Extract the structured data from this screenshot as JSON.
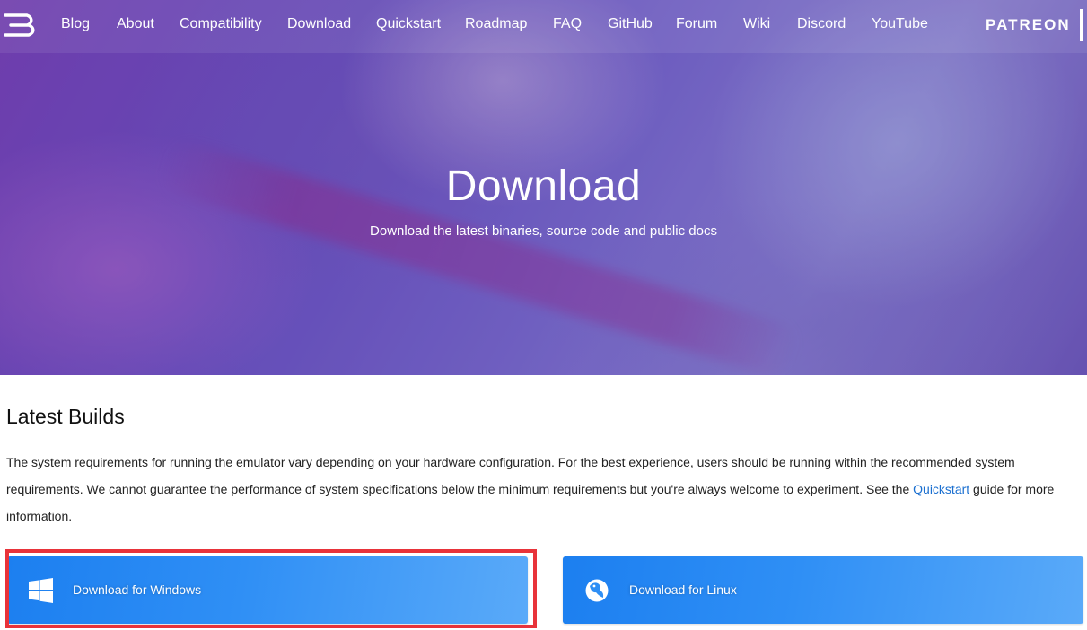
{
  "nav": {
    "logo_icon": "yuzu-logo-icon",
    "links": [
      {
        "label": "Blog"
      },
      {
        "label": "About"
      },
      {
        "label": "Compatibility"
      },
      {
        "label": "Download"
      },
      {
        "label": "Quickstart"
      },
      {
        "label": "Roadmap"
      },
      {
        "label": "FAQ"
      },
      {
        "label": "GitHub"
      },
      {
        "label": "Forum"
      },
      {
        "label": "Wiki"
      },
      {
        "label": "Discord"
      },
      {
        "label": "YouTube"
      }
    ],
    "patreon_label": "PATREON"
  },
  "hero": {
    "title": "Download",
    "subtitle": "Download the latest binaries, source code and public docs"
  },
  "content": {
    "section_title": "Latest Builds",
    "description_before": "The system requirements for running the emulator vary depending on your hardware configuration. For the best experience, users should be running within the recommended system requirements. We cannot guarantee the performance of system specifications below the minimum requirements but you're always welcome to experiment. See the ",
    "description_link": "Quickstart",
    "description_after": " guide for more information."
  },
  "downloads": {
    "windows_label": "Download for Windows",
    "windows_icon": "windows-icon",
    "linux_label": "Download for Linux",
    "linux_icon": "linux-icon"
  },
  "colors": {
    "button_blue": "#2f8ff5",
    "link_blue": "#1a6fd0",
    "highlight_red": "#e8333a"
  }
}
